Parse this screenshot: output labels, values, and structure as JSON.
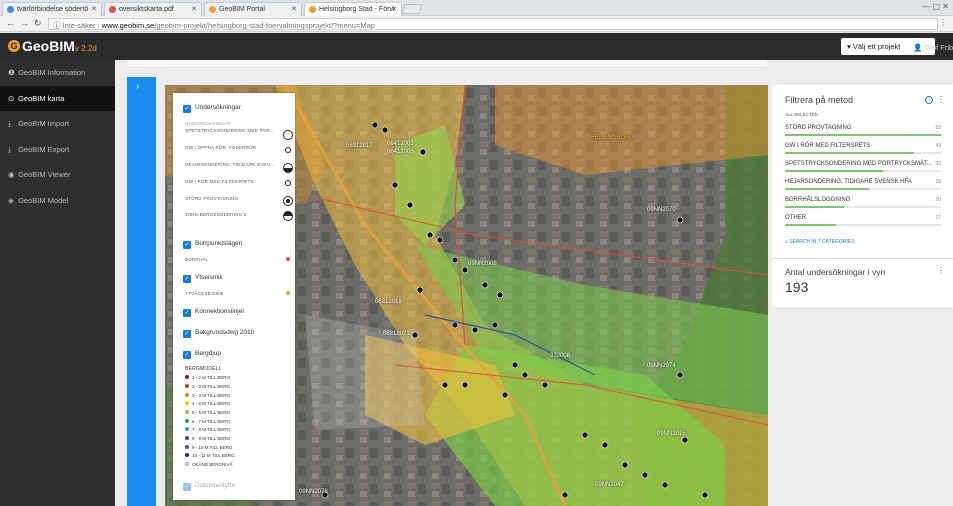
{
  "browser": {
    "tabs": [
      {
        "title": "tvärförbindelse södertö",
        "color": "#1a73e8"
      },
      {
        "title": "oversiktskarta.pdf",
        "color": "#d9534f"
      },
      {
        "title": "GeoBIM Portal",
        "color": "#f0a030"
      },
      {
        "title": "Helsingborg Stad - Förvi",
        "color": "#f0a030"
      }
    ],
    "url_info": "Inte säker",
    "url_domain": "www.geobim.se",
    "url_path": "/geobim-projekt/helsingborg-stad-foervaltningsprojekt/?menu=Map"
  },
  "app": {
    "logo": "GeoBIM",
    "version": "v 2.2d",
    "project_button": "▾ Välj ett projekt",
    "user": "Olof Fribe"
  },
  "sidebar": {
    "items": [
      {
        "label": "GeoBIM Information",
        "icon": "info-icon",
        "glyph": "❶"
      },
      {
        "label": "GeoBIM karta",
        "icon": "map-pin-icon",
        "glyph": "⊙"
      },
      {
        "label": "GeoBIM Import",
        "icon": "import-icon",
        "glyph": "⤓"
      },
      {
        "label": "GeoBIM Export",
        "icon": "export-icon",
        "glyph": "⤓"
      },
      {
        "label": "GeoBIM Viewer",
        "icon": "eye-icon",
        "glyph": "◉"
      },
      {
        "label": "GeoBIM Model",
        "icon": "model-icon",
        "glyph": "◈"
      }
    ]
  },
  "legend": {
    "undersokningar": "Undersökningar",
    "undersokningar_sub": "UNDERSÖKNINGAR",
    "methods": [
      "SPETSTRYCKSONDERING MED POR...",
      "GW I ÖPPNA RÖR, FODERRÖR",
      "HEJARSONDERING, TIDIGARE SVEN...",
      "GW I RÖR MED FILTERSPETS",
      "STÖRD PROVTAGNING",
      "JORD-BERGSONDERING 3"
    ],
    "borrpunkt": "Borrpunktslägen",
    "borrpunkt_sub": "BORRHÅL",
    "yteseismik": "Ytseismik",
    "yteseismik_sub": "YTVÅGSSEISMIK",
    "konnektion": "Konnektionslinjer",
    "bakgrund": "Bakgrundsdwg 2010",
    "bergdjup": "Bergdjup",
    "bergmodell": "BERGMODELL",
    "geo": [
      {
        "label": "1 - 2 M TILL BERG",
        "color": "#8b1a1a"
      },
      {
        "label": "2 - 3 M TILL BERG",
        "color": "#c0392b"
      },
      {
        "label": "3 - 4 M TILL BERG",
        "color": "#e67e22"
      },
      {
        "label": "4 - 5 M TILL BERG",
        "color": "#f1c40f"
      },
      {
        "label": "5 - 6 M TILL BERG",
        "color": "#8bc34a"
      },
      {
        "label": "6 - 7 M TILL BERG",
        "color": "#2e9b3a"
      },
      {
        "label": "7 - 8 M TILL BERG",
        "color": "#4a90d9"
      },
      {
        "label": "8 - 9 M TILL BERG",
        "color": "#2c4fa0"
      },
      {
        "label": "9 - 10 M TILL BERG",
        "color": "#6a3fa0"
      },
      {
        "label": "10 - 11 M TILL BERG",
        "color": "#3a1f6a"
      },
      {
        "label": "OKÄND BERGNIVÅ",
        "color": "#ffffff"
      }
    ],
    "dokument": "Dokumentytor"
  },
  "filter": {
    "title": "Filtrera på metod",
    "all_selected": "ALL SELECTED",
    "rows": [
      {
        "label": "STÖRD PROVTAGNING",
        "count": "52",
        "frac": 1.0
      },
      {
        "label": "GW I RÖR MED FILTERSPETS",
        "count": "43",
        "frac": 0.83
      },
      {
        "label": "SPETSTRYCKSONDERING MED PORTRYCKSMÄT...",
        "count": "33",
        "frac": 0.63
      },
      {
        "label": "HEJARSONDERING, TIDIGARE SVENSK HFA",
        "count": "28",
        "frac": 0.54
      },
      {
        "label": "BORRHÅLSLOGGNING",
        "count": "20",
        "frac": 0.38
      },
      {
        "label": "OTHER",
        "count": "17",
        "frac": 0.33
      }
    ],
    "search_link": "SEARCH IN 7 CATEGORIES"
  },
  "count": {
    "title": "Antal undersökningar i vyn",
    "value": "193"
  },
  "map": {
    "labels": [
      "09NN2070",
      "09NN2074",
      "09NN2015",
      "332008",
      "06312019",
      "06312021",
      "09NN2008",
      "09NN2047",
      "09NN2076",
      "HELSINGBORG",
      "06412003",
      "06412005",
      "06312017"
    ],
    "label_area": "HELSINGBORG"
  }
}
